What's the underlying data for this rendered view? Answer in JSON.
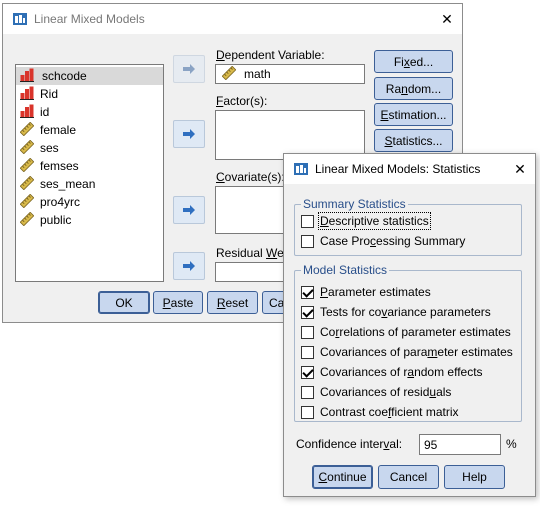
{
  "main_dialog": {
    "title": "Linear Mixed Models",
    "close_glyph": "✕",
    "variables": [
      {
        "name": "schcode",
        "icon": "nominal-icon",
        "selected": true
      },
      {
        "name": "Rid",
        "icon": "nominal-icon",
        "selected": false
      },
      {
        "name": "id",
        "icon": "nominal-icon",
        "selected": false
      },
      {
        "name": "female",
        "icon": "ruler-icon",
        "selected": false
      },
      {
        "name": "ses",
        "icon": "ruler-icon",
        "selected": false
      },
      {
        "name": "femses",
        "icon": "ruler-icon",
        "selected": false
      },
      {
        "name": "ses_mean",
        "icon": "ruler-icon",
        "selected": false
      },
      {
        "name": "pro4yrc",
        "icon": "ruler-icon",
        "selected": false
      },
      {
        "name": "public",
        "icon": "ruler-icon",
        "selected": false
      }
    ],
    "dependent_label_pre": "",
    "dependent_label_u": "D",
    "dependent_label_post": "ependent Variable:",
    "dependent_value": "math",
    "factors_label_u": "F",
    "factors_label_post": "actor(s):",
    "covariates_label_pre": "",
    "covariates_label_u": "C",
    "covariates_label_post": "ovariate(s):",
    "residual_label_pre": "Residual ",
    "residual_label_u": "W",
    "residual_label_post": "eight:",
    "side_buttons": {
      "fixed_pre": "Fi",
      "fixed_u": "x",
      "fixed_post": "ed...",
      "random_pre": "Ra",
      "random_u": "n",
      "random_post": "dom...",
      "estimation_pre": "",
      "estimation_u": "E",
      "estimation_post": "stimation...",
      "statistics_pre": "",
      "statistics_u": "S",
      "statistics_post": "tatistics..."
    },
    "bottom_buttons": {
      "ok": "OK",
      "paste_u": "P",
      "paste_post": "aste",
      "reset_u": "R",
      "reset_post": "eset",
      "cancel": "Cancel"
    }
  },
  "stats_dialog": {
    "title": "Linear Mixed Models: Statistics",
    "close_glyph": "✕",
    "summary_group_title": "Summary Statistics",
    "summary_items": [
      {
        "pre": "",
        "u": "D",
        "post": "escriptive statistics",
        "checked": false
      },
      {
        "pre": "Case Pro",
        "u": "c",
        "post": "essing Summary",
        "checked": false
      }
    ],
    "model_group_title": "Model Statistics",
    "model_items": [
      {
        "pre": "",
        "u": "P",
        "post": "arameter estimates",
        "checked": true
      },
      {
        "pre": "Tests for co",
        "u": "v",
        "post": "ariance parameters",
        "checked": true
      },
      {
        "pre": "Co",
        "u": "r",
        "post": "relations of parameter estimates",
        "checked": false
      },
      {
        "pre": "Covariances of para",
        "u": "m",
        "post": "eter estimates",
        "checked": false
      },
      {
        "pre": "Covariances of r",
        "u": "a",
        "post": "ndom effects",
        "checked": true
      },
      {
        "pre": "Covariances of resid",
        "u": "u",
        "post": "als",
        "checked": false
      },
      {
        "pre": "Contrast coe",
        "u": "f",
        "post": "ficient matrix",
        "checked": false
      }
    ],
    "confidence_label_pre": "Confidence inter",
    "confidence_label_u": "v",
    "confidence_label_post": "al:",
    "confidence_value": "95",
    "percent_sign": "%",
    "buttons": {
      "continue_pre": "",
      "continue_u": "C",
      "continue_post": "ontinue",
      "cancel": "Cancel",
      "help": "Help"
    }
  },
  "colors": {
    "button_fill": "#c8d7ee",
    "button_border": "#3c5f96",
    "group_title": "#284e8a",
    "dialog_bg": "#f0f0f0"
  }
}
